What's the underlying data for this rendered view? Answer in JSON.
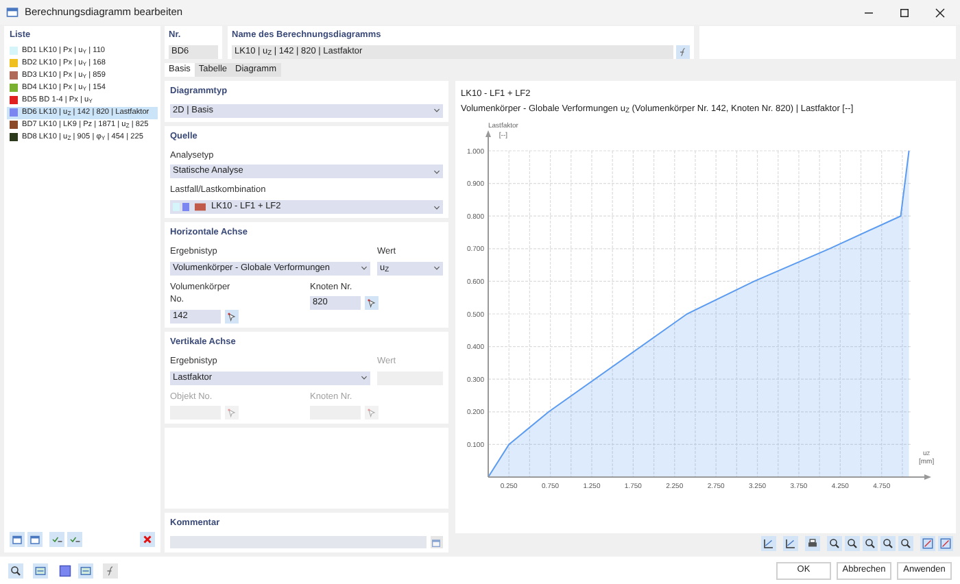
{
  "window": {
    "title": "Berechnungsdiagramm bearbeiten"
  },
  "list": {
    "title": "Liste",
    "items": [
      {
        "label": "BD1 LK10 | Px | u$_{Y}$ | 110",
        "color": "#d6f5fa",
        "selected": false
      },
      {
        "label": "BD2 LK10 | Px | u$_{Y}$ | 168",
        "color": "#f0c020",
        "selected": false
      },
      {
        "label": "BD3 LK10 | Px | u$_{Y}$ | 859",
        "color": "#b06a5a",
        "selected": false
      },
      {
        "label": "BD4 LK10 | Px | u$_{Y}$ | 154",
        "color": "#7ab030",
        "selected": false
      },
      {
        "label": "BD5 BD 1-4 | Px | u$_{Y}$",
        "color": "#e02020",
        "selected": false
      },
      {
        "label": "BD6 LK10 | u$_{Z}$ | 142 | 820 | Lastfaktor",
        "color": "#7b86f0",
        "selected": true
      },
      {
        "label": "BD7 LK10 | LK9 | Pz | 1871 | u$_{Z}$ | 825",
        "color": "#8b4a2a",
        "selected": false
      },
      {
        "label": "BD8 LK10 | u$_{Z}$ | 905 | φ$_{Y}$ | 454 | 225",
        "color": "#2a3a1a",
        "selected": false
      }
    ]
  },
  "nr": {
    "label": "Nr.",
    "value": "BD6"
  },
  "name": {
    "label": "Name des Berechnungsdiagramms",
    "value": "LK10 | u$_{Z}$ | 142 | 820 | Lastfaktor"
  },
  "tabs": [
    {
      "label": "Basis",
      "selected": true
    },
    {
      "label": "Tabelle",
      "selected": false
    },
    {
      "label": "Diagramm",
      "selected": false
    }
  ],
  "diagram_type": {
    "title": "Diagrammtyp",
    "field": {
      "kind": "select",
      "value": "2D | Basis",
      "disabled": false
    }
  },
  "source": {
    "title": "Quelle",
    "analysis_type": {
      "kind": "select",
      "label": "Analysetyp",
      "value": "Statische Analyse",
      "disabled": false
    },
    "load_case": {
      "kind": "combo",
      "label": "Lastfall/Lastkombination",
      "value": "LK10 - LF1 + LF2",
      "disabled": false
    }
  },
  "horizontal_axis": {
    "title": "Horizontale Achse",
    "result_type": {
      "kind": "select",
      "label": "Ergebnistyp",
      "value": "Volumenkörper - Globale Verformungen",
      "disabled": false
    },
    "value": {
      "kind": "select",
      "label": "Wert",
      "value": "u$_{Z}$",
      "disabled": false
    },
    "solid": {
      "kind": "pick",
      "label": "Volumenkörper No.",
      "value": "142",
      "disabled": false
    },
    "node": {
      "kind": "pick",
      "label": "Knoten Nr.",
      "value": "820",
      "disabled": false
    }
  },
  "vertical_axis": {
    "title": "Vertikale Achse",
    "result_type": {
      "kind": "select",
      "label": "Ergebnistyp",
      "value": "Lastfaktor",
      "disabled": false
    },
    "value": {
      "kind": "input",
      "label": "Wert",
      "disabled": true
    },
    "object": {
      "kind": "pick",
      "label": "Objekt No.",
      "disabled": true
    },
    "node": {
      "kind": "pick",
      "label": "Knoten Nr.",
      "disabled": true
    }
  },
  "comment": {
    "label": "Kommentar"
  },
  "chart": {
    "title": "LK10 - LF1 + LF2",
    "subtitle": "Volumenkörper - Globale Verformungen u$_{Z}$ (Volumenkörper Nr. 142, Knoten Nr. 820) | Lastfaktor [--]",
    "ylabel": "Lastfaktor",
    "yunit": "[--]",
    "xlabel": "u$_{Z}$",
    "xunit": "[mm]",
    "chart_data": {
      "type": "area",
      "grid": true,
      "x": [
        0,
        0.25,
        0.73,
        2.4,
        3.21,
        4.12,
        4.98,
        5.08
      ],
      "series": [
        {
          "color": "#5b9bf0",
          "values": [
            0,
            0.1,
            0.2,
            0.5,
            0.6,
            0.7,
            0.8,
            1.0
          ]
        }
      ],
      "xlim": [
        0,
        5.1
      ],
      "ylim": [
        0,
        1
      ],
      "xticks": [
        {
          "value": 0.25,
          "label": "0.250"
        },
        {
          "value": 0.75,
          "label": "0.750"
        },
        {
          "value": 1.25,
          "label": "1.250"
        },
        {
          "value": 1.75,
          "label": "1.750"
        },
        {
          "value": 2.25,
          "label": "2.250"
        },
        {
          "value": 2.75,
          "label": "2.750"
        },
        {
          "value": 3.25,
          "label": "3.250"
        },
        {
          "value": 3.75,
          "label": "3.750"
        },
        {
          "value": 4.25,
          "label": "4.250"
        },
        {
          "value": 4.75,
          "label": "4.750"
        }
      ],
      "yticks": [
        {
          "value": 0.1,
          "label": "0.100"
        },
        {
          "value": 0.2,
          "label": "0.200"
        },
        {
          "value": 0.3,
          "label": "0.300"
        },
        {
          "value": 0.4,
          "label": "0.400"
        },
        {
          "value": 0.5,
          "label": "0.500"
        },
        {
          "value": 0.6,
          "label": "0.600"
        },
        {
          "value": 0.7,
          "label": "0.700"
        },
        {
          "value": 0.8,
          "label": "0.800"
        },
        {
          "value": 0.9,
          "label": "0.900"
        },
        {
          "value": 1.0,
          "label": "1.000"
        }
      ]
    }
  },
  "buttons": [
    "OK",
    "Abbrechen",
    "Anwenden"
  ]
}
